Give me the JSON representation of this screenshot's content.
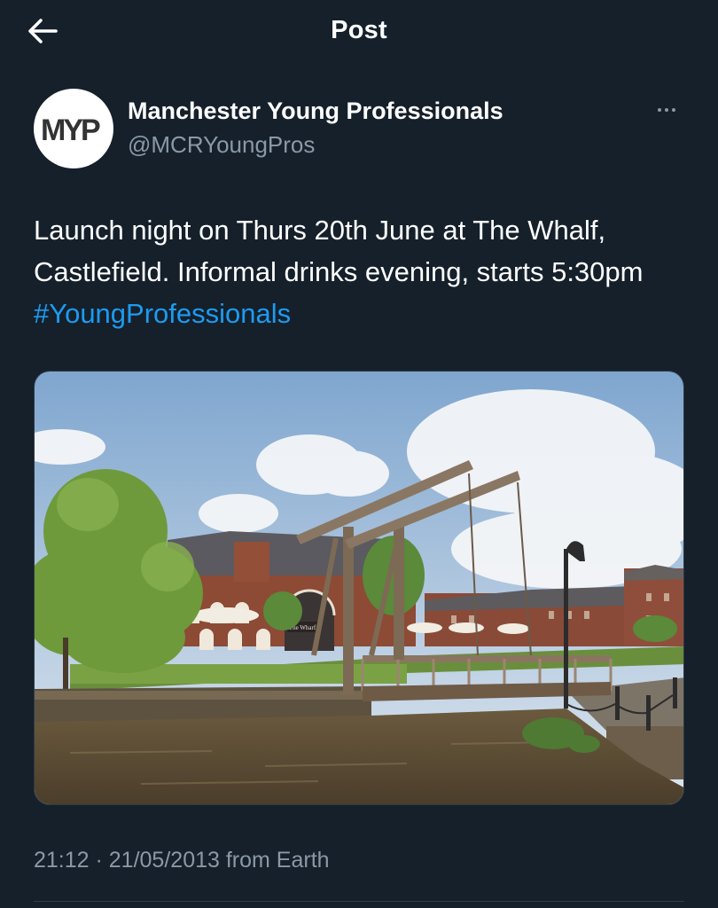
{
  "header": {
    "title": "Post",
    "back_icon": "arrow-left-icon"
  },
  "author": {
    "logo_text": "MYP",
    "display_name": "Manchester Young Professionals",
    "handle": "@MCRYoungPros",
    "more_icon": "more-horizontal-icon"
  },
  "tweet": {
    "text_main": "Launch night on Thurs 20th June at The Whalf, Castlefield. Informal drinks evening, starts 5:30pm ",
    "hashtag": "#YoungProfessionals"
  },
  "media": {
    "pub_sign": "The Wharf"
  },
  "meta": {
    "timestamp": "21:12 · 21/05/2013 from Earth"
  },
  "colors": {
    "background": "#15202b",
    "secondary_text": "#8b98a5",
    "link": "#1d9bf0"
  }
}
